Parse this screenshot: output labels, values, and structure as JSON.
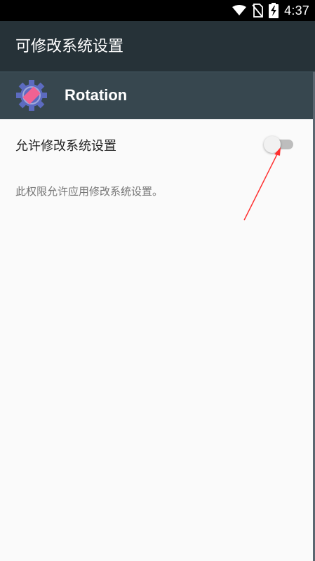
{
  "status_bar": {
    "time": "4:37",
    "icons": [
      "wifi-icon",
      "no-sim-icon",
      "battery-charging-icon"
    ]
  },
  "app_bar": {
    "title": "可修改系统设置"
  },
  "app_header": {
    "app_name": "Rotation",
    "icon": "rotation-app-icon"
  },
  "setting": {
    "label": "允许修改系统设置",
    "toggle_state": "off",
    "description": "此权限允许应用修改系统设置。"
  },
  "annotation": {
    "type": "red-arrow",
    "color": "#ff3030",
    "points_to": "toggle"
  }
}
